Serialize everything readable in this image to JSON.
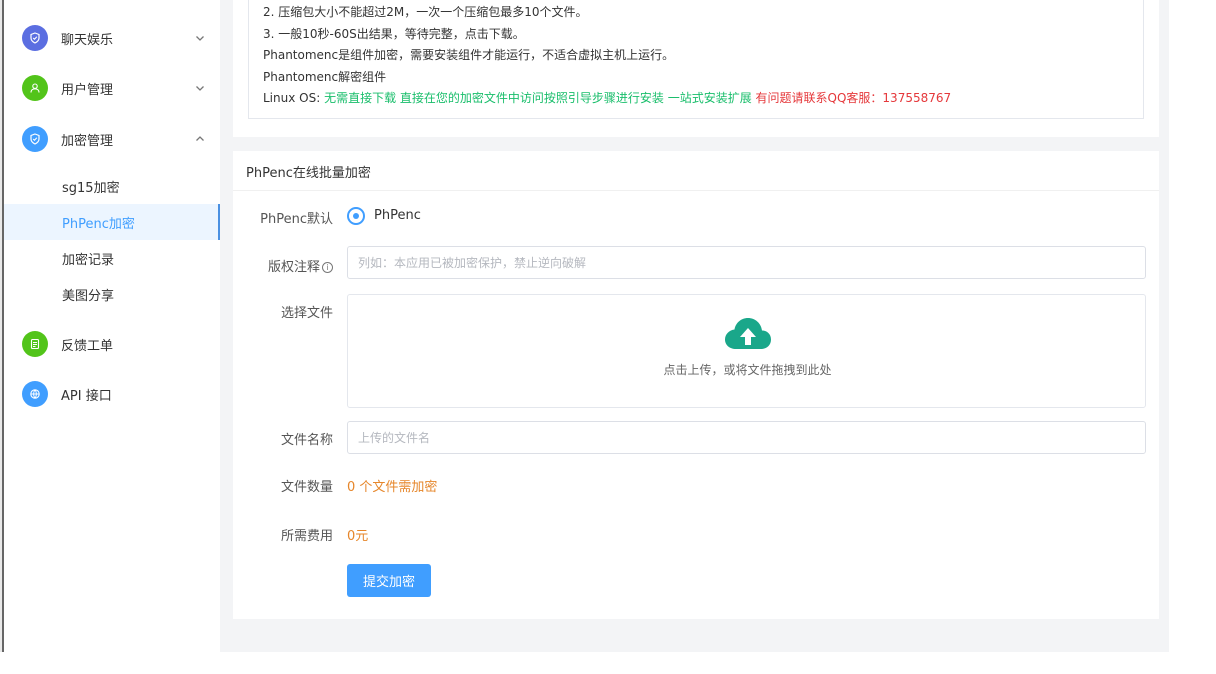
{
  "sidebar": {
    "items": [
      {
        "label": "聊天娱乐",
        "icon": "shield-icon",
        "color": "#5b6ee1"
      },
      {
        "label": "用户管理",
        "icon": "user-icon",
        "color": "#52c41a"
      },
      {
        "label": "加密管理",
        "icon": "shield-icon",
        "color": "#409eff"
      },
      {
        "label": "反馈工单",
        "icon": "document-icon",
        "color": "#52c41a"
      },
      {
        "label": "API 接口",
        "icon": "globe-icon",
        "color": "#409eff"
      }
    ],
    "subitems": [
      {
        "label": "sg15加密"
      },
      {
        "label": "PhPenc加密",
        "active": true
      },
      {
        "label": "加密记录"
      },
      {
        "label": "美图分享"
      }
    ]
  },
  "notice": {
    "line2": "2. 压缩包大小不能超过2M，一次一个压缩包最多10个文件。",
    "line3": "3. 一般10秒-60S出结果，等待完整，点击下载。",
    "line4": "Phantomenc是组件加密，需要安装组件才能运行，不适合虚拟主机上运行。",
    "line5": "Phantomenc解密组件",
    "linux_prefix": "Linux OS: ",
    "linux_green": "无需直接下载 直接在您的加密文件中访问按照引导步骤进行安装 一站式安装扩展",
    "linux_red": " 有问题请联系QQ客服：137558767"
  },
  "form": {
    "title": "PhPenc在线批量加密",
    "default_label": "PhPenc默认",
    "default_option": "PhPenc",
    "copyright_label": "版权注释",
    "copyright_placeholder": "列如：本应用已被加密保护，禁止逆向破解",
    "file_label": "选择文件",
    "upload_text": "点击上传，或将文件拖拽到此处",
    "filename_label": "文件名称",
    "filename_placeholder": "上传的文件名",
    "count_label": "文件数量",
    "count_value": "0 个文件需加密",
    "fee_label": "所需费用",
    "fee_value": "0元",
    "submit_label": "提交加密"
  },
  "colors": {
    "accent": "#409eff",
    "success": "#19be6b",
    "danger": "#e5383b",
    "warning": "#e6862a"
  }
}
